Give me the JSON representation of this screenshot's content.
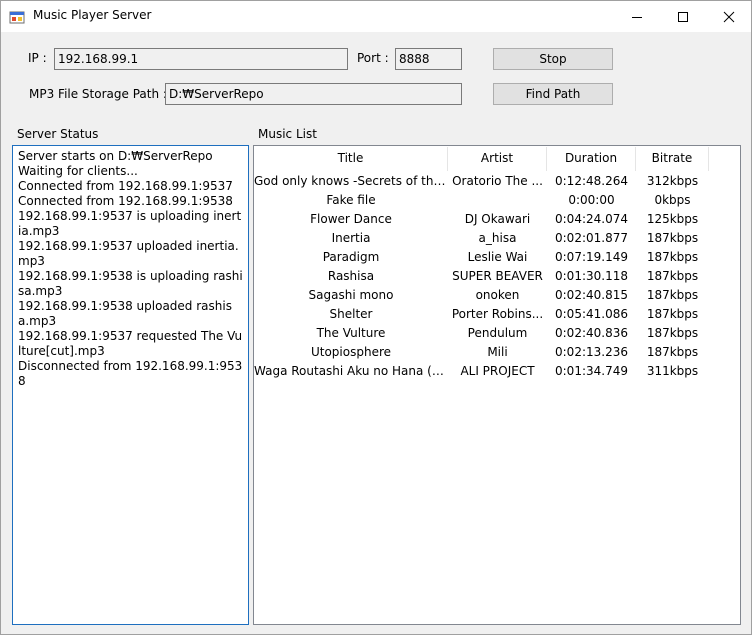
{
  "window": {
    "title": "Music Player Server"
  },
  "connection": {
    "ip_label": "IP :",
    "ip_value": "192.168.99.1",
    "port_label": "Port :",
    "port_value": "8888",
    "stop_label": "Stop",
    "path_label": "MP3 File Storage Path :",
    "path_value": "D:₩ServerRepo",
    "find_path_label": "Find Path"
  },
  "server_status": {
    "heading": "Server Status",
    "lines": [
      "Server starts on D:₩ServerRepo",
      "Waiting for clients...",
      "Connected from 192.168.99.1:9537",
      "Connected from 192.168.99.1:9538",
      "192.168.99.1:9537 is uploading inertia.mp3",
      "192.168.99.1:9537 uploaded inertia.mp3",
      "192.168.99.1:9538 is uploading rashisa.mp3",
      "192.168.99.1:9538 uploaded rashisa.mp3",
      "192.168.99.1:9537 requested The Vulture[cut].mp3",
      "Disconnected from 192.168.99.1:9538"
    ]
  },
  "music_list": {
    "heading": "Music List",
    "columns": [
      "Title",
      "Artist",
      "Duration",
      "Bitrate"
    ],
    "rows": [
      [
        "God only knows -Secrets of the...",
        "Oratorio The ...",
        "0:12:48.264",
        "312kbps"
      ],
      [
        "Fake file",
        "",
        "0:00:00",
        "0kbps"
      ],
      [
        "Flower Dance",
        "DJ Okawari",
        "0:04:24.074",
        "125kbps"
      ],
      [
        "Inertia",
        "a_hisa",
        "0:02:01.877",
        "187kbps"
      ],
      [
        "Paradigm",
        "Leslie Wai",
        "0:07:19.149",
        "187kbps"
      ],
      [
        "Rashisa",
        "SUPER BEAVER",
        "0:01:30.118",
        "187kbps"
      ],
      [
        "Sagashi mono",
        "onoken",
        "0:02:40.815",
        "187kbps"
      ],
      [
        "Shelter",
        "Porter Robins...",
        "0:05:41.086",
        "187kbps"
      ],
      [
        "The Vulture",
        "Pendulum",
        "0:02:40.836",
        "187kbps"
      ],
      [
        "Utopiosphere",
        "Mili",
        "0:02:13.236",
        "187kbps"
      ],
      [
        "Waga Routashi Aku no Hana (T...",
        "ALI PROJECT",
        "0:01:34.749",
        "311kbps"
      ]
    ]
  }
}
